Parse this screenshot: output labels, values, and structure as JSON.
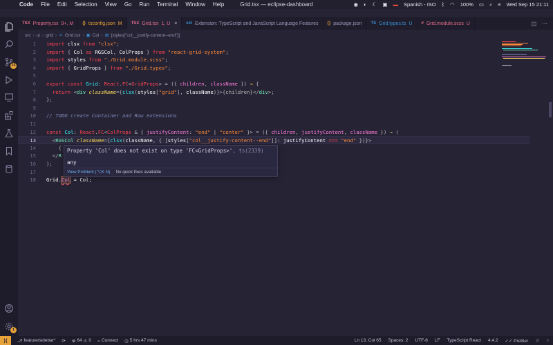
{
  "menubar": {
    "app": "Code",
    "items": [
      "File",
      "Edit",
      "Selection",
      "View",
      "Go",
      "Run",
      "Terminal",
      "Window",
      "Help"
    ],
    "window_title": "Grid.tsx — eclipse-dashboard",
    "input_source": "Spanish - ISO",
    "battery": "100%",
    "clock": "Wed Sep 15  21:11"
  },
  "tabs": [
    {
      "label": "Property.tsx",
      "status": "9+, M",
      "icon": "TSX",
      "color": "#e36c8a",
      "active": false
    },
    {
      "label": "tsconfig.json",
      "status": "M",
      "icon": "{}",
      "color": "#e7a23a",
      "active": false
    },
    {
      "label": "Grid.tsx",
      "status": "1, U",
      "icon": "TSX",
      "color": "#e36c8a",
      "active": true
    },
    {
      "label": "Extension: TypeScript and JavaScript Language Features",
      "status": "",
      "icon": "ext",
      "color": "#3b8ed0",
      "active": false
    },
    {
      "label": "package.json",
      "status": "",
      "icon": "{}",
      "color": "#e7a23a",
      "active": false
    },
    {
      "label": "Grid.types.ts",
      "status": "U",
      "icon": "TS",
      "color": "#3b8ed0",
      "active": false
    },
    {
      "label": "Grid.module.scss",
      "status": "U",
      "icon": "#",
      "color": "#e36c8a",
      "active": false
    }
  ],
  "breadcrumb": [
    "src",
    "ui",
    "grid",
    "Grid.tsx",
    "Col",
    "[styles[\"col__justify-content--end\"]]"
  ],
  "editor": {
    "lines": [
      {
        "n": "1",
        "tokens": [
          [
            "kw2",
            "import"
          ],
          [
            "plain",
            " clsx "
          ],
          [
            "kw2",
            "from"
          ],
          [
            "str",
            " \"clsx\""
          ],
          [
            "pun",
            ";"
          ]
        ]
      },
      {
        "n": "2",
        "tokens": [
          [
            "kw2",
            "import"
          ],
          [
            "pun",
            " { "
          ],
          [
            "plain",
            "Col "
          ],
          [
            "kw2",
            "as"
          ],
          [
            "plain",
            " RGSCol"
          ],
          [
            "pun",
            ", "
          ],
          [
            "plain",
            "ColProps "
          ],
          [
            "pun",
            "} "
          ],
          [
            "kw2",
            "from"
          ],
          [
            "str",
            " \"react-grid-system\""
          ],
          [
            "pun",
            ";"
          ]
        ]
      },
      {
        "n": "3",
        "tokens": [
          [
            "kw2",
            "import"
          ],
          [
            "plain",
            " styles "
          ],
          [
            "kw2",
            "from"
          ],
          [
            "str",
            " \"./Grid.module.scss\""
          ],
          [
            "pun",
            ";"
          ]
        ]
      },
      {
        "n": "4",
        "tokens": [
          [
            "kw2",
            "import"
          ],
          [
            "pun",
            " { "
          ],
          [
            "plain",
            "GridProps "
          ],
          [
            "pun",
            "} "
          ],
          [
            "kw2",
            "from"
          ],
          [
            "str",
            " \"./Grid.types\""
          ],
          [
            "pun",
            ";"
          ]
        ]
      },
      {
        "n": "5",
        "tokens": []
      },
      {
        "n": "6",
        "tokens": [
          [
            "kw2",
            "export"
          ],
          [
            "kw2",
            " const "
          ],
          [
            "fn",
            "Grid"
          ],
          [
            "pun",
            ": "
          ],
          [
            "typ",
            "React"
          ],
          [
            "pun",
            "."
          ],
          [
            "typ",
            "FC"
          ],
          [
            "pun",
            "<"
          ],
          [
            "typ",
            "GridProps"
          ],
          [
            "pun",
            "> = ({ "
          ],
          [
            "prop",
            "children"
          ],
          [
            "pun",
            ", "
          ],
          [
            "prop",
            "className"
          ],
          [
            "pun",
            " }) "
          ],
          [
            "kw",
            "⇒"
          ],
          [
            "pun",
            " {"
          ]
        ]
      },
      {
        "n": "7",
        "tokens": [
          [
            "plain",
            "  "
          ],
          [
            "kw2",
            "return"
          ],
          [
            "pun",
            " <"
          ],
          [
            "tag",
            "div"
          ],
          [
            "attr",
            " className"
          ],
          [
            "pun",
            "={"
          ],
          [
            "fn",
            "clsx"
          ],
          [
            "pun",
            "("
          ],
          [
            "plain",
            "styles"
          ],
          [
            "pun",
            "["
          ],
          [
            "str",
            "\"grid\""
          ],
          [
            "pun",
            "], "
          ],
          [
            "plain",
            "className"
          ],
          [
            "pun",
            ")}>"
          ],
          [
            "pun",
            "{children}"
          ],
          [
            "pun",
            "</"
          ],
          [
            "tag",
            "div"
          ],
          [
            "pun",
            ">;"
          ]
        ]
      },
      {
        "n": "8",
        "tokens": [
          [
            "pun",
            "};"
          ]
        ]
      },
      {
        "n": "9",
        "tokens": []
      },
      {
        "n": "10",
        "tokens": [
          [
            "cm",
            "// TODO create Container and Row extensions"
          ]
        ]
      },
      {
        "n": "11",
        "tokens": []
      },
      {
        "n": "12",
        "tokens": [
          [
            "kw2",
            "const "
          ],
          [
            "fn",
            "Col"
          ],
          [
            "pun",
            ": "
          ],
          [
            "typ",
            "React"
          ],
          [
            "pun",
            "."
          ],
          [
            "typ",
            "FC"
          ],
          [
            "pun",
            "<"
          ],
          [
            "typ",
            "ColProps"
          ],
          [
            "pun",
            " & { "
          ],
          [
            "prop",
            "justifyContent"
          ],
          [
            "pun",
            ": "
          ],
          [
            "str",
            "\"end\""
          ],
          [
            "pun",
            " | "
          ],
          [
            "str",
            "\"center\""
          ],
          [
            "pun",
            " }> = ({ "
          ],
          [
            "prop",
            "children"
          ],
          [
            "pun",
            ", "
          ],
          [
            "prop",
            "justifyContent"
          ],
          [
            "pun",
            ", "
          ],
          [
            "prop",
            "className"
          ],
          [
            "pun",
            " }) "
          ],
          [
            "kw",
            "⇒"
          ],
          [
            "pun",
            " ("
          ]
        ]
      },
      {
        "n": "13",
        "tokens": [
          [
            "pun",
            "  <"
          ],
          [
            "tag",
            "RGSCol"
          ],
          [
            "attr",
            " className"
          ],
          [
            "pun",
            "={"
          ],
          [
            "fn",
            "clsx"
          ],
          [
            "pun",
            "("
          ],
          [
            "plain",
            "className"
          ],
          [
            "pun",
            ", { ["
          ],
          [
            "plain",
            "styles"
          ],
          [
            "pun",
            "["
          ],
          [
            "str",
            "\"col__justify-content--end\""
          ],
          [
            "pun",
            "]]: "
          ],
          [
            "plain",
            "justifyContent"
          ],
          [
            "kw2",
            " === "
          ],
          [
            "str",
            "\"end\""
          ],
          [
            "pun",
            " })}>"
          ]
        ]
      },
      {
        "n": "14",
        "tokens": [
          [
            "pun",
            "    {"
          ]
        ]
      },
      {
        "n": "15",
        "tokens": [
          [
            "pun",
            "  </"
          ],
          [
            "tag",
            "R"
          ]
        ]
      },
      {
        "n": "16",
        "tokens": [
          [
            "pun",
            ");"
          ]
        ]
      },
      {
        "n": "17",
        "tokens": []
      },
      {
        "n": "18",
        "tokens": [
          [
            "plain",
            "Grid."
          ],
          [
            "err",
            "Col"
          ],
          [
            "plain",
            " = Col;"
          ]
        ]
      }
    ],
    "current_line": "13"
  },
  "hover": {
    "message": "Property 'Col' does not exist on type 'FC<GridProps>'.",
    "code": "ts(2339)",
    "type": "any",
    "view_problem": "View Problem (⌥K N)",
    "no_fixes": "No quick fixes available"
  },
  "statusbar": {
    "branch": "feature/sidebar*",
    "errors": "64",
    "warnings": "0",
    "connect": "Connect",
    "time": "5 hrs 47 mins",
    "position": "Ln 13, Col 65",
    "spaces": "Spaces: 2",
    "encoding": "UTF-8",
    "eol": "LF",
    "language": "TypeScript React",
    "ts_version": "4.4.2",
    "formatter": "Prettier"
  },
  "activity": {
    "scm_badge": "15"
  }
}
